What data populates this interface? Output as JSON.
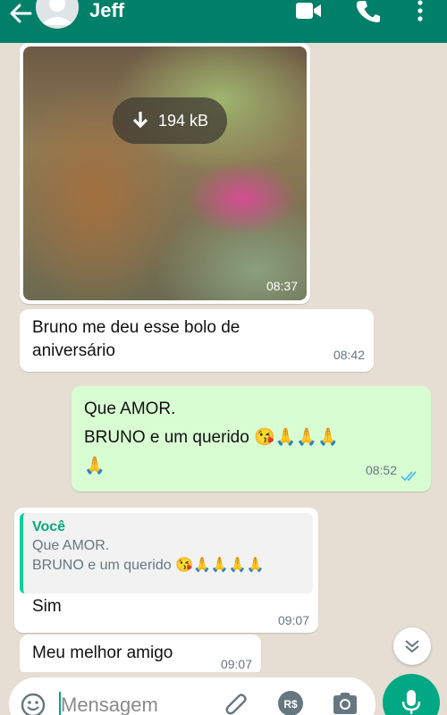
{
  "header": {
    "contact_name": "Jeff",
    "background_color": "#008069",
    "icons": [
      "back-arrow-icon",
      "avatar-icon",
      "video-call-icon",
      "phone-icon",
      "more-vert-icon"
    ]
  },
  "messages": {
    "image": {
      "download_size": "194 kB",
      "time": "08:37"
    },
    "text1": {
      "line1": "Bruno me deu esse bolo de",
      "line2": "aniversário",
      "time": "08:42"
    },
    "text2": {
      "line1": "Que AMOR.",
      "line2": "BRUNO e um querido 😘🙏🙏🙏",
      "line3": "🙏",
      "time": "08:52",
      "status": "read"
    },
    "reply": {
      "quote_author": "Você",
      "quote_line1": "Que AMOR.",
      "quote_line2": "BRUNO e um querido 😘🙏🙏🙏🙏",
      "text": "Sim",
      "time": "09:07"
    },
    "text3": {
      "text": "Meu melhor amigo",
      "time": "09:07"
    }
  },
  "input": {
    "placeholder": "Mensagem",
    "icons": [
      "emoji-icon",
      "attach-icon",
      "payment-icon",
      "camera-icon",
      "mic-icon"
    ],
    "accent_color": "#00a884"
  }
}
